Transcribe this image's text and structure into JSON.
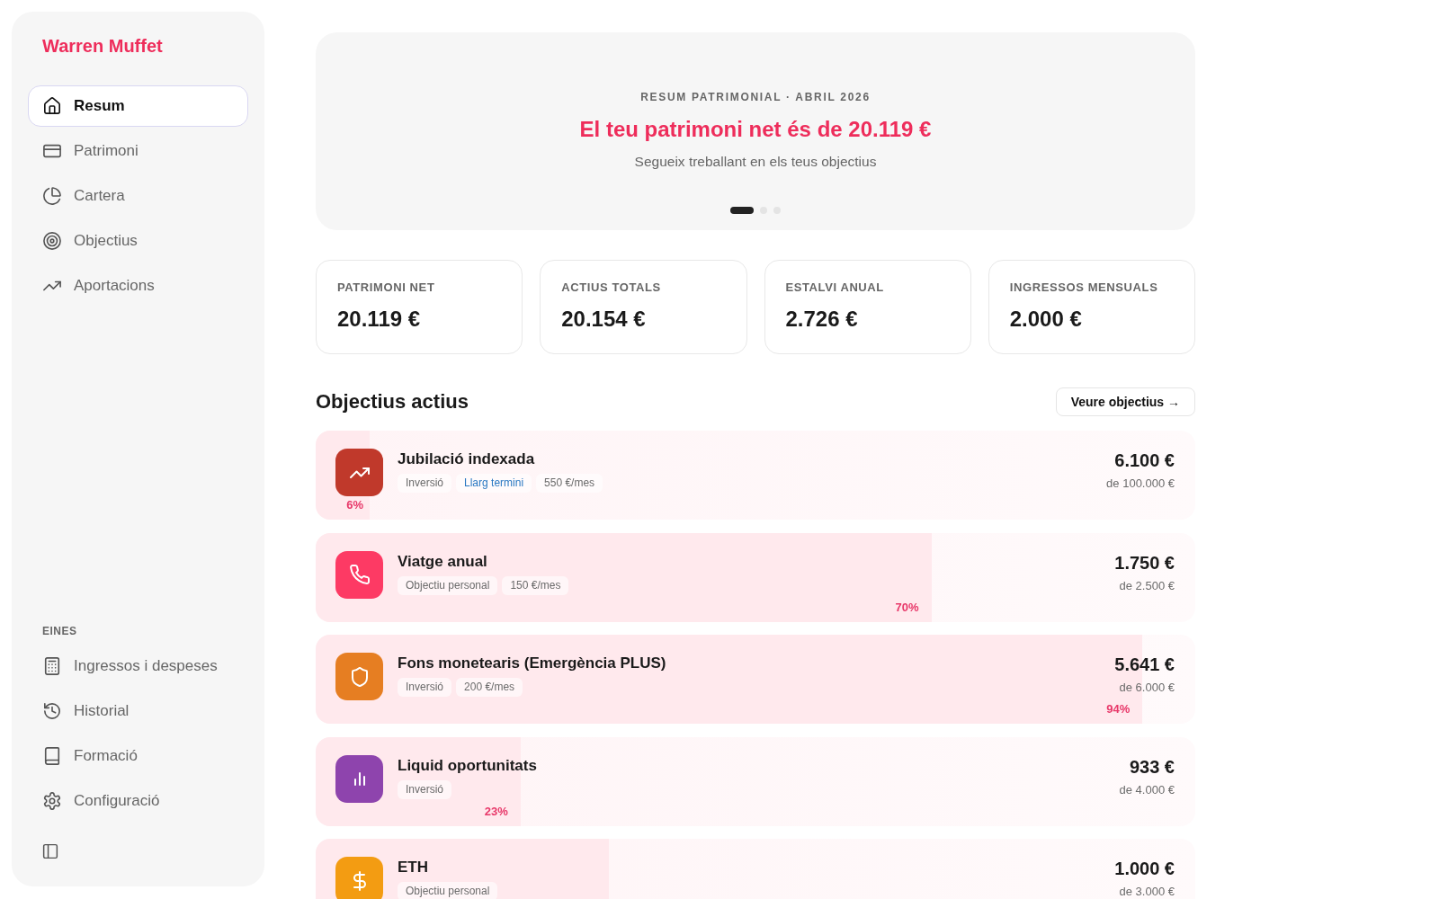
{
  "sidebar": {
    "brand": "Warren Muffet",
    "items": [
      {
        "label": "Resum",
        "selected": true
      },
      {
        "label": "Patrimoni",
        "selected": false
      },
      {
        "label": "Cartera",
        "selected": false
      },
      {
        "label": "Objectius",
        "selected": false
      },
      {
        "label": "Aportacions",
        "selected": false
      }
    ],
    "tools_label": "EINES",
    "tools": [
      {
        "label": "Ingressos i despeses",
        "selected": false
      },
      {
        "label": "Historial",
        "selected": false
      },
      {
        "label": "Formació",
        "selected": false
      },
      {
        "label": "Configuració",
        "selected": false
      }
    ]
  },
  "hero": {
    "eyebrow": "RESUM PATRIMONIAL · ABRIL 2026",
    "headline": "El teu patrimoni net és de 20.119 €",
    "subtitle": "Segueix treballant en els teus objectius",
    "dots": [
      {
        "selected": true
      },
      {
        "selected": false
      },
      {
        "selected": false
      }
    ]
  },
  "stats": [
    {
      "label": "PATRIMONI NET",
      "value": "20.119 €"
    },
    {
      "label": "ACTIUS TOTALS",
      "value": "20.154 €"
    },
    {
      "label": "ESTALVI ANUAL",
      "value": "2.726 €"
    },
    {
      "label": "INGRESSOS MENSUALS",
      "value": "2.000 €"
    }
  ],
  "goals_header": {
    "title": "Objectius actius",
    "button": "Veure objectius →"
  },
  "goals": [
    {
      "title": "Jubilació indexada",
      "color": "#c0392b",
      "tags": [
        {
          "text": "Inversió",
          "kind": "plain"
        },
        {
          "text": "Llarg termini",
          "kind": "accent"
        },
        {
          "text": "550 €/mes",
          "kind": "plain"
        }
      ],
      "amount": "6.100 €",
      "target": "de 100.000 €",
      "percent": "6%",
      "level": 0.061
    },
    {
      "title": "Viatge anual",
      "color": "#fd3a64",
      "tags": [
        {
          "text": "Objectiu personal",
          "kind": "plain"
        },
        {
          "text": "150 €/mes",
          "kind": "plain"
        }
      ],
      "amount": "1.750 €",
      "target": "de 2.500 €",
      "percent": "70%",
      "level": 0.7
    },
    {
      "title": "Fons monetearis (Emergència PLUS)",
      "color": "#e67e22",
      "tags": [
        {
          "text": "Inversió",
          "kind": "plain"
        },
        {
          "text": "200 €/mes",
          "kind": "plain"
        }
      ],
      "amount": "5.641 €",
      "target": "de 6.000 €",
      "percent": "94%",
      "level": 0.94
    },
    {
      "title": "Liquid oportunitats",
      "color": "#8e44ad",
      "tags": [
        {
          "text": "Inversió",
          "kind": "plain"
        }
      ],
      "amount": "933 €",
      "target": "de 4.000 €",
      "percent": "23%",
      "level": 0.233
    },
    {
      "title": "ETH",
      "color": "#f39c12",
      "tags": [
        {
          "text": "Objectiu personal",
          "kind": "plain"
        }
      ],
      "amount": "1.000 €",
      "target": "de 3.000 €",
      "level": 0.333
    }
  ]
}
